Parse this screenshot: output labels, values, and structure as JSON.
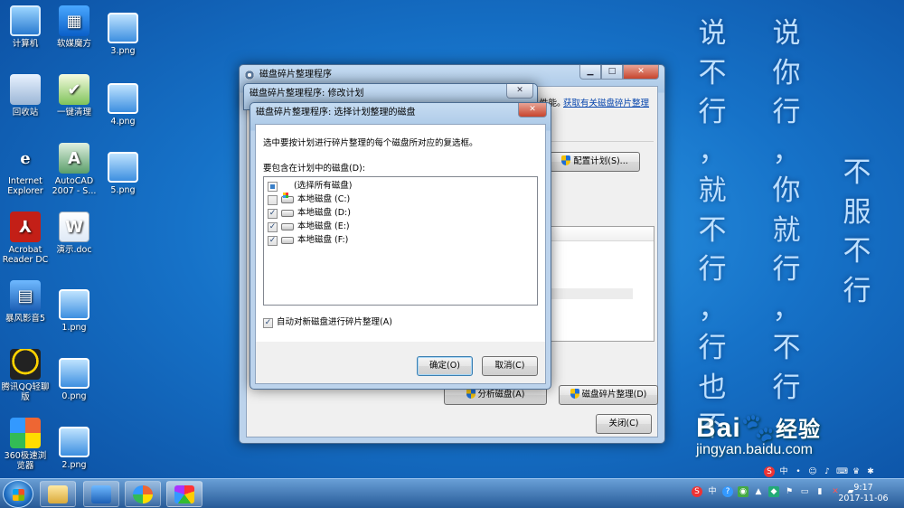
{
  "desktop": {
    "icons": [
      {
        "label": "计算机",
        "icon": "computer-icon"
      },
      {
        "label": "软媒魔方",
        "icon": "softmedia-cube-icon"
      },
      {
        "label": "3.png",
        "icon": "png-file-icon"
      },
      {
        "label": "回收站",
        "icon": "recycle-bin-icon"
      },
      {
        "label": "一键清理",
        "icon": "one-click-clean-icon"
      },
      {
        "label": "4.png",
        "icon": "png-file-icon"
      },
      {
        "label": "Internet Explorer",
        "icon": "internet-explorer-icon"
      },
      {
        "label": "AutoCAD 2007 - S...",
        "icon": "autocad-icon"
      },
      {
        "label": "5.png",
        "icon": "png-file-icon"
      },
      {
        "label": "Acrobat Reader DC",
        "icon": "acrobat-reader-icon"
      },
      {
        "label": "演示.doc",
        "icon": "word-doc-icon"
      },
      {
        "label": "暴风影音5",
        "icon": "baofeng-player-icon"
      },
      {
        "label": "1.png",
        "icon": "png-file-icon"
      },
      {
        "label": "腾讯QQ轻聊版",
        "icon": "qq-icon"
      },
      {
        "label": "0.png",
        "icon": "png-file-icon"
      },
      {
        "label": "360极速浏览器",
        "icon": "360-browser-icon"
      },
      {
        "label": "2.png",
        "icon": "png-file-icon"
      }
    ],
    "slogan": {
      "col1": [
        "说",
        "不",
        "行",
        "，",
        "就",
        "不",
        "行",
        "，",
        "行",
        "也",
        "不"
      ],
      "col2": [
        "说",
        "你",
        "行",
        "，",
        "你",
        "就",
        "行",
        "，",
        "不",
        "行"
      ],
      "col3": [
        "不",
        "服",
        "不",
        "行"
      ]
    },
    "watermark": {
      "brand": "Bai",
      "brand_cn": "经验",
      "url": "jingyan.baidu.com"
    }
  },
  "main_window": {
    "title": "磁盘碎片整理程序",
    "partial_text": "性能。",
    "help_link": "获取有关磁盘碎片整理",
    "configure_button": "配置计划(S)...",
    "analyze_button": "分析磁盘(A)",
    "defrag_button": "磁盘碎片整理(D)",
    "close_button": "关闭(C)"
  },
  "modify_window": {
    "title": "磁盘碎片整理程序: 修改计划"
  },
  "select_dialog": {
    "title": "磁盘碎片整理程序: 选择计划整理的磁盘",
    "instruction": "选中要按计划进行碎片整理的每个磁盘所对应的复选框。",
    "list_label": "要包含在计划中的磁盘(D):",
    "disks": [
      {
        "label": "(选择所有磁盘)",
        "state": "partial"
      },
      {
        "label": "本地磁盘 (C:)",
        "state": "unchecked"
      },
      {
        "label": "本地磁盘 (D:)",
        "state": "checked"
      },
      {
        "label": "本地磁盘 (E:)",
        "state": "checked"
      },
      {
        "label": "本地磁盘 (F:)",
        "state": "checked"
      }
    ],
    "auto_option": "自动对新磁盘进行碎片整理(A)",
    "auto_checked": true,
    "ok_button": "确定(O)",
    "cancel_button": "取消(C)"
  },
  "taskbar": {
    "time": "9:17",
    "date": "2017-11-06"
  },
  "colors": {
    "desktop": "#1672c8",
    "slogan": "#bfe0ff",
    "link": "#0645ad"
  }
}
